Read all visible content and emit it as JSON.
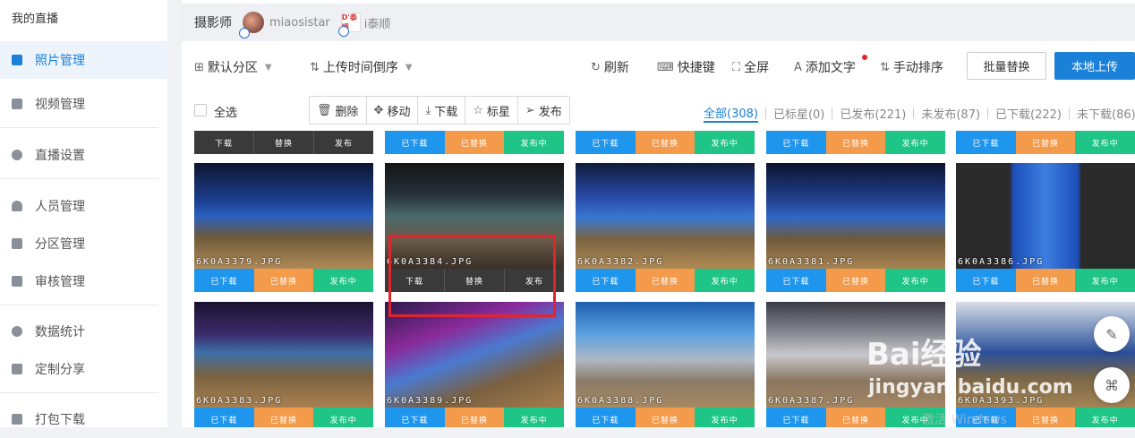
{
  "sidebar": {
    "title": "我的直播",
    "items": [
      {
        "label": "照片管理",
        "icon": "image-icon"
      },
      {
        "label": "视频管理",
        "icon": "video-icon"
      },
      {
        "label": "直播设置",
        "icon": "settings-icon"
      },
      {
        "label": "人员管理",
        "icon": "user-icon"
      },
      {
        "label": "分区管理",
        "icon": "list-icon"
      },
      {
        "label": "审核管理",
        "icon": "review-icon"
      },
      {
        "label": "数据统计",
        "icon": "pie-chart-icon"
      },
      {
        "label": "定制分享",
        "icon": "share-icon"
      },
      {
        "label": "打包下载",
        "icon": "download-icon"
      }
    ],
    "active": "照片管理"
  },
  "header": {
    "title": "摄影师",
    "users": [
      "miaosistar",
      "i泰顺"
    ],
    "logo_text": "D'泰顺"
  },
  "toolbar": {
    "partition": "默认分区",
    "sort": "上传时间倒序",
    "refresh": "刷新",
    "shortcut": "快捷键",
    "fullscreen": "全屏",
    "add_text": "添加文字",
    "manual_sort": "手动排序",
    "batch_replace": "批量替换",
    "local_upload": "本地上传"
  },
  "actions": {
    "select_all": "全选",
    "delete": "删除",
    "move": "移动",
    "download": "下载",
    "star": "标星",
    "publish": "发布"
  },
  "filters": [
    "全部(308)",
    "已标星(0)",
    "已发布(221)",
    "未发布(87)",
    "已下载(222)",
    "未下载(86)"
  ],
  "card_labels": {
    "downloaded": "已下载",
    "replaced": "已替换",
    "publishing": "发布中",
    "download": "下载",
    "replace": "替换",
    "publish": "发布"
  },
  "photos": [
    "6K0A3379.JPG",
    "6K0A3384.JPG",
    "6K0A3382.JPG",
    "6K0A3381.JPG",
    "6K0A3386.JPG",
    "6K0A3383.JPG",
    "6K0A3389.JPG",
    "6K0A3388.JPG",
    "6K0A3387.JPG",
    "6K0A3393.JPG"
  ],
  "watermark": {
    "brand": "Bai经验",
    "url": "jingyan.baidu.com",
    "sub": "激活 Windows"
  },
  "colors": {
    "accent": "#1a80d8",
    "downloaded": "#1f96ee",
    "replaced": "#f49a4b",
    "publishing": "#1fc487",
    "highlight": "#e0262c"
  }
}
